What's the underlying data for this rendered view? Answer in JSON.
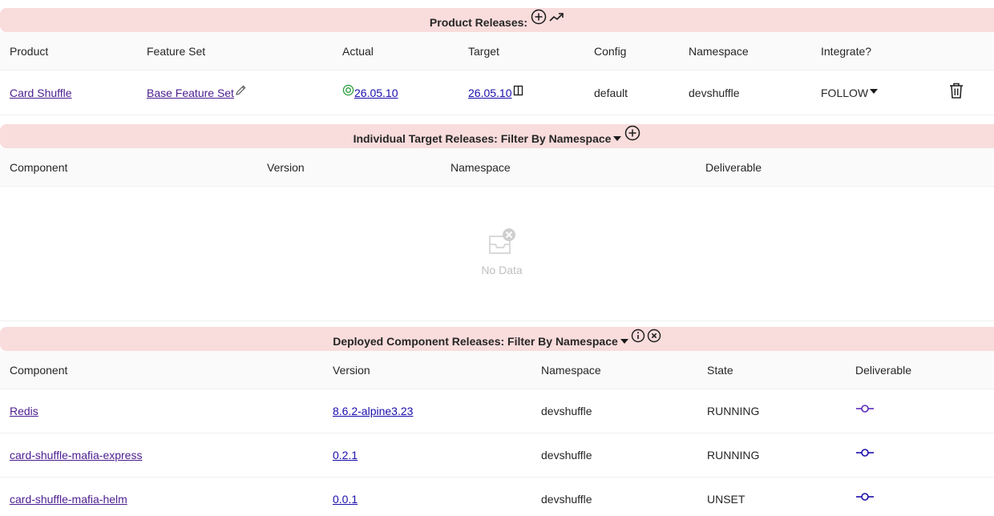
{
  "product_releases": {
    "title": "Product Releases:",
    "columns": [
      "Product",
      "Feature Set",
      "Actual",
      "Target",
      "Config",
      "Namespace",
      "Integrate?"
    ],
    "row": {
      "product": "Card Shuffle",
      "feature_set": "Base Feature Set",
      "actual": "26.05.10",
      "target": "26.05.10",
      "config": "default",
      "namespace": "devshuffle",
      "integrate": "FOLLOW"
    }
  },
  "individual_target_releases": {
    "title": "Individual Target Releases: Filter By Namespace",
    "columns": [
      "Component",
      "Version",
      "Namespace",
      "Deliverable"
    ],
    "empty_text": "No Data"
  },
  "deployed_component_releases": {
    "title": "Deployed Component Releases: Filter By Namespace",
    "columns": [
      "Component",
      "Version",
      "Namespace",
      "State",
      "Deliverable"
    ],
    "rows": [
      {
        "component": "Redis",
        "version": "8.6.2-alpine3.23",
        "namespace": "devshuffle",
        "state": "RUNNING"
      },
      {
        "component": "card-shuffle-mafia-express",
        "version": "0.2.1",
        "namespace": "devshuffle",
        "state": "RUNNING"
      },
      {
        "component": "card-shuffle-mafia-helm",
        "version": "0.0.1",
        "namespace": "devshuffle",
        "state": "UNSET"
      }
    ]
  },
  "colors": {
    "header_band": "#f9dcdc",
    "link": "#4b1d8f",
    "version_link": "#1a0dab",
    "commit_icon": "#5b2bbf",
    "actual_ok": "#2e9e3e"
  }
}
